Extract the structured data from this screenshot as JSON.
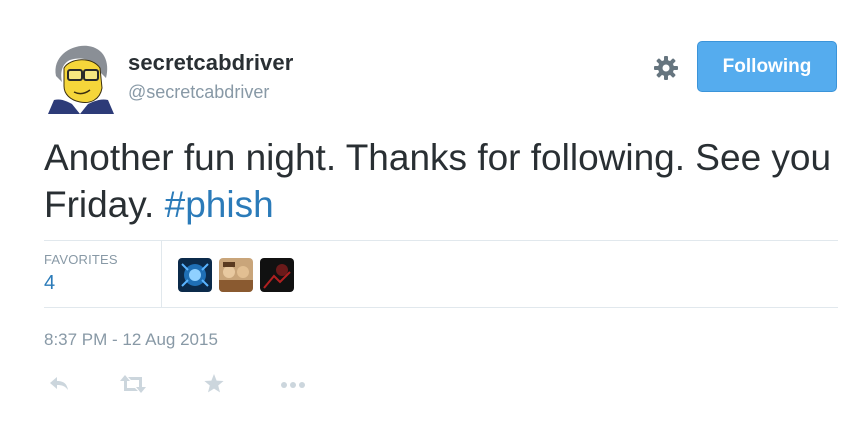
{
  "tweet": {
    "display_name": "secretcabdriver",
    "handle": "@secretcabdriver",
    "text_main": "Another fun night. Thanks for following. See you Friday. ",
    "hashtag": "#phish",
    "timestamp": "8:37 PM - 12 Aug 2015"
  },
  "follow_button": {
    "label": "Following"
  },
  "stats": {
    "favorites_label": "FAVORITES",
    "favorites_count": "4"
  },
  "icons": {
    "settings": "gear-icon",
    "reply": "reply-icon",
    "retweet": "retweet-icon",
    "favorite": "star-icon",
    "more": "more-icon"
  },
  "colors": {
    "accent": "#55acee",
    "link": "#2b7bb9",
    "muted": "#8899a6",
    "text": "#292f33",
    "action_icon": "#ccd6dd"
  }
}
